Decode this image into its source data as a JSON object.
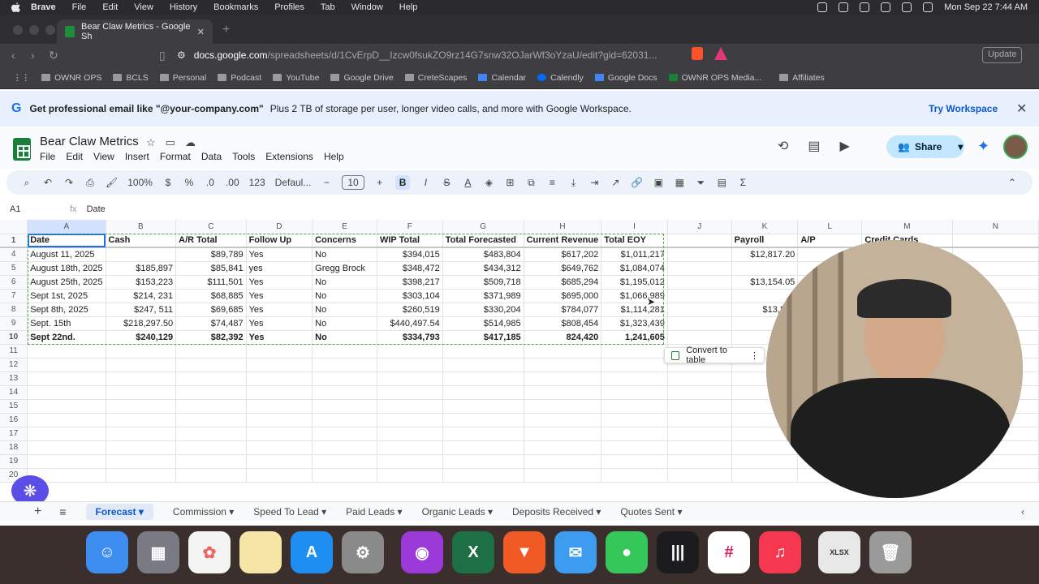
{
  "mac_menu": {
    "app": "Brave",
    "items": [
      "File",
      "Edit",
      "View",
      "History",
      "Bookmarks",
      "Profiles",
      "Tab",
      "Window",
      "Help"
    ],
    "clock": "Mon Sep 22  7:44 AM"
  },
  "browser": {
    "tab_title": "Bear Claw Metrics - Google Sh",
    "url_host": "docs.google.com",
    "url_path": "/spreadsheets/d/1CvErpD__Izcw0fsukZO9rz14G7snw32OJarWf3oYzaU/edit?gid=62031...",
    "update_label": "Update",
    "bookmarks": [
      "OWNR OPS",
      "BCLS",
      "Personal",
      "Podcast",
      "YouTube",
      "Google Drive",
      "CreteScapes",
      "Calendar",
      "Calendly",
      "Google Docs",
      "OWNR OPS Media...",
      "Affiliates"
    ]
  },
  "banner": {
    "strong": "Get professional email like \"@your-company.com\"",
    "rest": "Plus 2 TB of storage per user, longer video calls, and more with Google Workspace.",
    "cta": "Try Workspace"
  },
  "doc": {
    "title": "Bear Claw Metrics",
    "menus": [
      "File",
      "Edit",
      "View",
      "Insert",
      "Format",
      "Data",
      "Tools",
      "Extensions",
      "Help"
    ],
    "share_label": "Share"
  },
  "toolbar": {
    "zoom": "100%",
    "currency": "$",
    "percent": "%",
    "dec_minus": ".0",
    "dec_plus": ".00",
    "num_format": "123",
    "font": "Defaul...",
    "font_size": "10",
    "bold": "B",
    "italic": "I",
    "strike": "S",
    "text_color": "A"
  },
  "formula_bar": {
    "cell_ref": "A1",
    "fx": "fx",
    "content": "Date"
  },
  "grid": {
    "columns": [
      "A",
      "B",
      "C",
      "D",
      "E",
      "F",
      "G",
      "H",
      "I",
      "J",
      "K",
      "L",
      "M",
      "N"
    ],
    "header_row": {
      "num": "1",
      "cells": [
        "Date",
        "Cash",
        "A/R Total",
        "Follow Up",
        "Concerns",
        "WIP Total",
        "Total Forecasted",
        "Current Revenue",
        "Total EOY",
        "",
        "Payroll",
        "A/P",
        "Credit Cards",
        ""
      ]
    },
    "rows": [
      {
        "num": "4",
        "cells": [
          "August 11, 2025",
          "",
          "$89,789",
          "Yes",
          "No",
          "$394,015",
          "$483,804",
          "$617,202",
          "$1,011,217",
          "",
          "$12,817.20",
          "",
          "",
          " "
        ]
      },
      {
        "num": "5",
        "cells": [
          "August 18th, 2025",
          "$185,897",
          "$85,841",
          "yes",
          "Gregg Brock",
          "$348,472",
          "$434,312",
          "$649,762",
          "$1,084,074",
          "",
          "",
          "",
          "",
          ""
        ]
      },
      {
        "num": "6",
        "cells": [
          "August 25th, 2025",
          "$153,223",
          "$111,501",
          "Yes",
          "No",
          "$398,217",
          "$509,718",
          "$685,294",
          "$1,195,012",
          "",
          "$13,154.05",
          "",
          "",
          ""
        ]
      },
      {
        "num": "7",
        "cells": [
          "Sept 1st, 2025",
          "$214, 231",
          "$68,885",
          "Yes",
          "No",
          "$303,104",
          "$371,989",
          "$695,000",
          "$1,066,989",
          "",
          "",
          "",
          "",
          ""
        ]
      },
      {
        "num": "8",
        "cells": [
          "Sept 8th, 2025",
          "$247, 511",
          "$69,685",
          "Yes",
          "No",
          "$260,519",
          "$330,204",
          "$784,077",
          "$1,114,281",
          "",
          "$13,897",
          "",
          "",
          ""
        ]
      },
      {
        "num": "9",
        "cells": [
          "Sept. 15th",
          "$218,297.50",
          "$74,487",
          "Yes",
          "No",
          "$440,497.54",
          "$514,985",
          "$808,454",
          "$1,323,439",
          "",
          "",
          "",
          "",
          ""
        ]
      },
      {
        "num": "10",
        "cells": [
          "Sept 22nd.",
          "$240,129",
          "$82,392",
          "Yes",
          "No",
          "$334,793",
          "$417,185",
          "824,420",
          "1,241,605",
          "",
          "$15,4",
          "",
          "",
          ""
        ]
      }
    ],
    "empty_rows": [
      "11",
      "12",
      "13",
      "14",
      "15",
      "16",
      "17",
      "18",
      "19",
      "20"
    ]
  },
  "convert_label": "Convert to table",
  "sheet_tabs": [
    "Forecast",
    "Commission",
    "Speed To Lead",
    "Paid Leads",
    "Organic Leads",
    "Deposits Received",
    "Quotes Sent"
  ],
  "dock": [
    "Finder",
    "Launchpad",
    "Photos",
    "Notes",
    "App Store",
    "System Settings",
    "Podcasts",
    "Excel",
    "Brave",
    "Mail",
    "Messages",
    "Stocks",
    "Slack",
    "Music",
    "XLSX",
    "Trash"
  ]
}
